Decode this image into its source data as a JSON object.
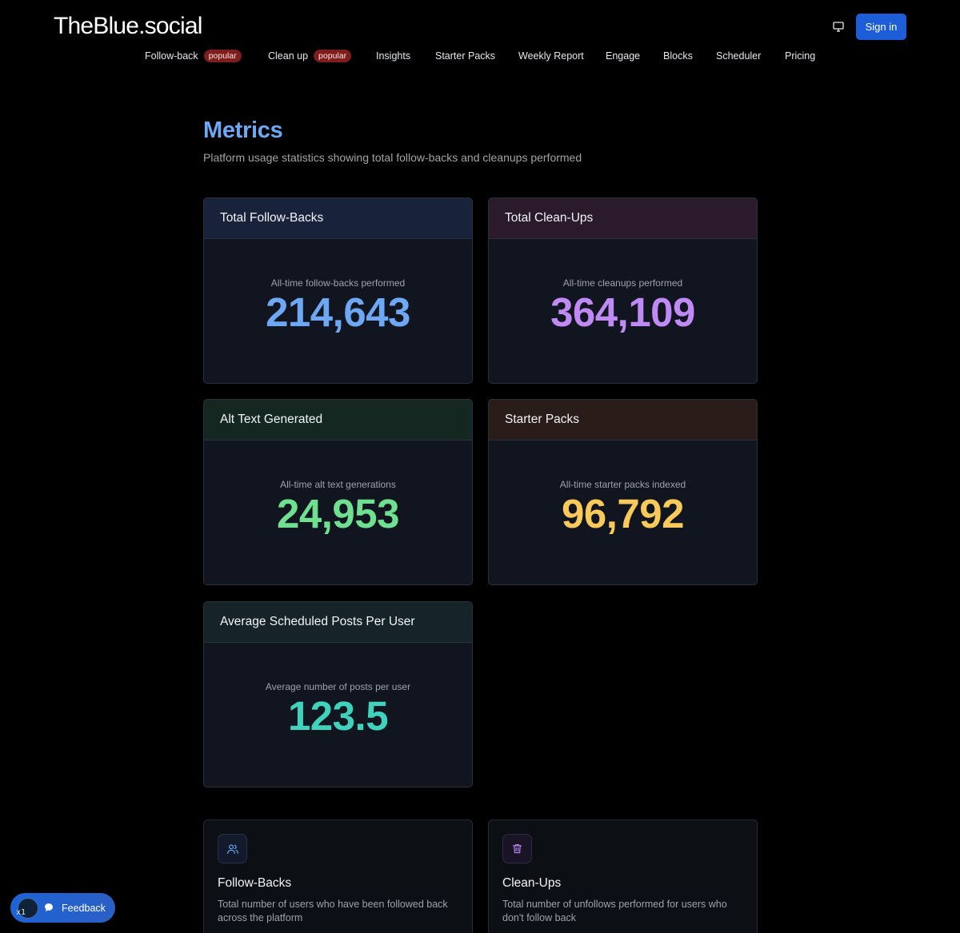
{
  "header": {
    "logo": "TheBlue.social",
    "sign_in_label": "Sign in",
    "monitor_icon": "monitor-icon"
  },
  "nav": {
    "items": [
      {
        "label": "Follow-back",
        "badge": "popular"
      },
      {
        "label": "Clean up",
        "badge": "popular"
      },
      {
        "label": "Insights"
      },
      {
        "label": "Starter Packs"
      },
      {
        "label": "Weekly Report"
      },
      {
        "label": "Engage"
      },
      {
        "label": "Blocks"
      },
      {
        "label": "Scheduler"
      },
      {
        "label": "Pricing"
      }
    ]
  },
  "page": {
    "title": "Metrics",
    "subtitle": "Platform usage statistics showing total follow-backs and cleanups performed"
  },
  "metrics": [
    {
      "title": "Total Follow-Backs",
      "label": "All-time follow-backs performed",
      "value": "214,643",
      "color": "#6ea8f5"
    },
    {
      "title": "Total Clean-Ups",
      "label": "All-time cleanups performed",
      "value": "364,109",
      "color": "#c08af5"
    },
    {
      "title": "Alt Text Generated",
      "label": "All-time alt text generations",
      "value": "24,953",
      "color": "#6fe08f"
    },
    {
      "title": "Starter Packs",
      "label": "All-time starter packs indexed",
      "value": "96,792",
      "color": "#f9c95a"
    },
    {
      "title": "Average Scheduled Posts Per User",
      "label": "Average number of posts per user",
      "value": "123.5",
      "color": "#3fd3bd"
    }
  ],
  "features": [
    {
      "title": "Follow-Backs",
      "description": "Total number of users who have been followed back across the platform",
      "icon": "users-icon",
      "color": "#6ea8f5"
    },
    {
      "title": "Clean-Ups",
      "description": "Total number of unfollows performed for users who don't follow back",
      "icon": "trash-icon",
      "color": "#c08af5"
    }
  ],
  "feedback": {
    "label": "Feedback",
    "tag": "x1"
  }
}
